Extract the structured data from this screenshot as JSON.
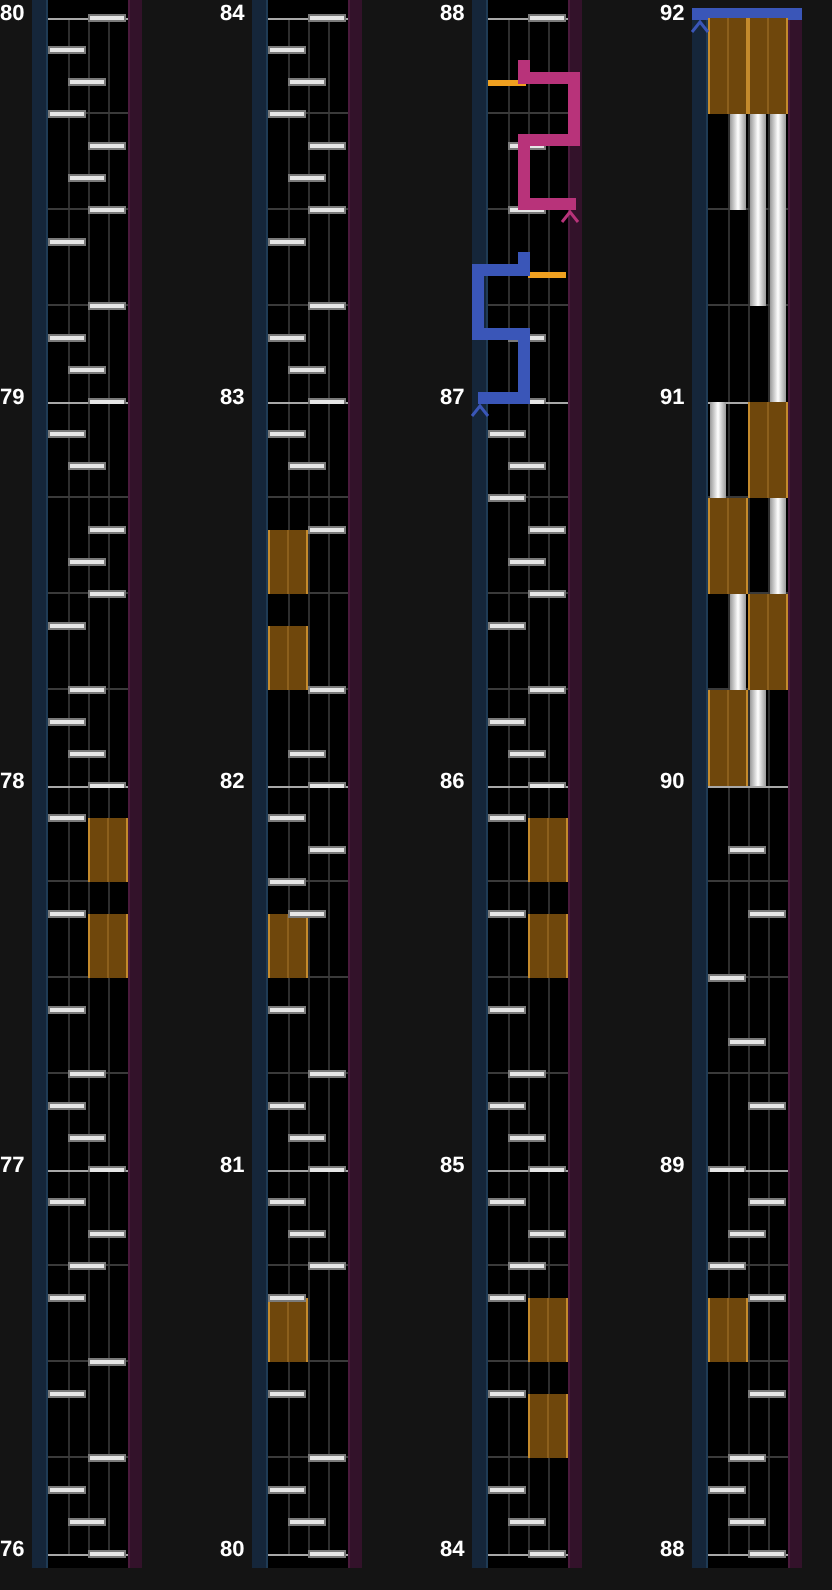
{
  "columns": [
    {
      "top_label": "80",
      "measures": [
        {
          "number": "79"
        },
        {
          "number": "78"
        },
        {
          "number": "77"
        },
        {
          "number": "76"
        }
      ]
    },
    {
      "top_label": "84",
      "measures": [
        {
          "number": "83"
        },
        {
          "number": "82"
        },
        {
          "number": "81"
        },
        {
          "number": "80"
        }
      ]
    },
    {
      "top_label": "88",
      "connectors": [
        {
          "kind": "upper",
          "color": "#b8337a"
        },
        {
          "kind": "lower",
          "color": "#3a56b8"
        }
      ],
      "measures": [
        {
          "number": "87"
        },
        {
          "number": "86"
        },
        {
          "number": "85"
        },
        {
          "number": "84"
        }
      ]
    },
    {
      "top_label": "92",
      "connectors": [
        {
          "kind": "top",
          "color": "#3a56b8"
        }
      ],
      "measures": [
        {
          "number": "91"
        },
        {
          "number": "90"
        },
        {
          "number": "89"
        },
        {
          "number": "88"
        }
      ]
    }
  ]
}
